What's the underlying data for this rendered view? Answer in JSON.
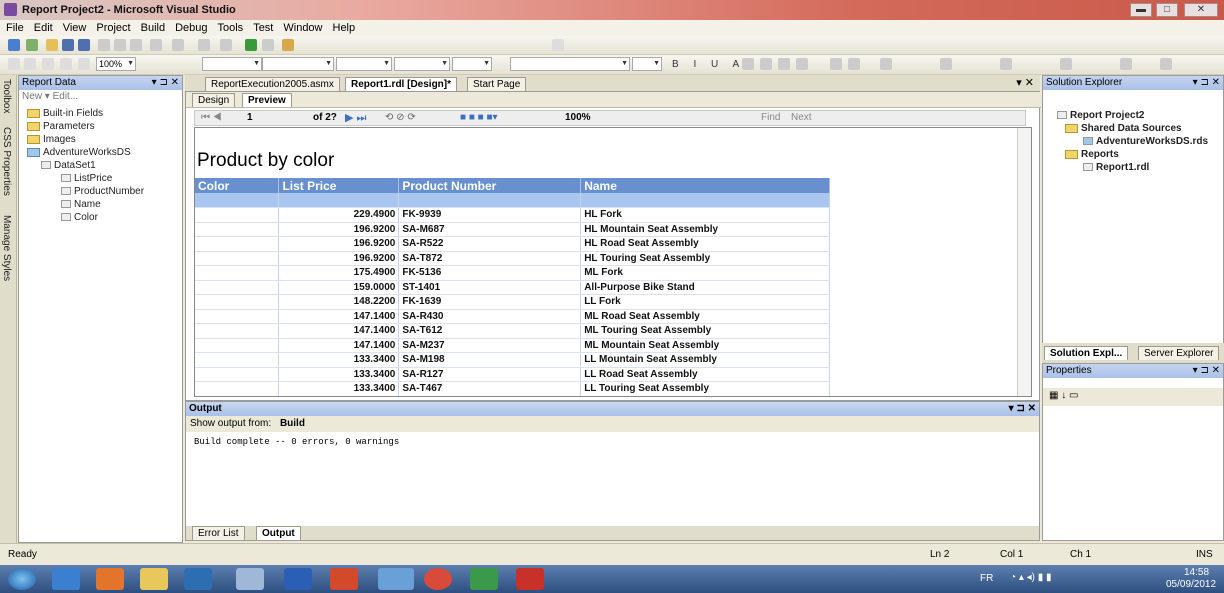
{
  "window": {
    "title": "Report Project2 - Microsoft Visual Studio"
  },
  "menu": [
    "File",
    "Edit",
    "View",
    "Project",
    "Build",
    "Debug",
    "Tools",
    "Test",
    "Window",
    "Help"
  ],
  "toolbar": {
    "zoom_combo": "100%"
  },
  "left_tabs": {
    "toolbox": "Toolbox",
    "css": "CSS Properties",
    "styles": "Manage Styles"
  },
  "report_data": {
    "title": "Report Data",
    "toolbar": "New ▾  Edit...",
    "tree": [
      "Built-in Fields",
      "Parameters",
      "Images",
      "AdventureWorksDS",
      "DataSet1",
      "ListPrice",
      "ProductNumber",
      "Name",
      "Color"
    ]
  },
  "doc_tabs": [
    "ReportExecution2005.asmx",
    "Report1.rdl [Design]*",
    "Start Page"
  ],
  "design_tabs": {
    "design": "Design",
    "preview": "Preview"
  },
  "viewer_toolbar": {
    "page": "1",
    "of": "of 2?",
    "zoom": "100%",
    "find": "Find",
    "next": "Next"
  },
  "report": {
    "title": "Product by color",
    "columns": [
      "Color",
      "List Price",
      "Product Number",
      "Name"
    ],
    "rows": [
      [
        "",
        "229.4900",
        "FK-9939",
        "HL Fork"
      ],
      [
        "",
        "196.9200",
        "SA-M687",
        "HL Mountain Seat Assembly"
      ],
      [
        "",
        "196.9200",
        "SA-R522",
        "HL Road Seat Assembly"
      ],
      [
        "",
        "196.9200",
        "SA-T872",
        "HL Touring Seat Assembly"
      ],
      [
        "",
        "175.4900",
        "FK-5136",
        "ML Fork"
      ],
      [
        "",
        "159.0000",
        "ST-1401",
        "All-Purpose Bike Stand"
      ],
      [
        "",
        "148.2200",
        "FK-1639",
        "LL Fork"
      ],
      [
        "",
        "147.1400",
        "SA-R430",
        "ML Road Seat Assembly"
      ],
      [
        "",
        "147.1400",
        "SA-T612",
        "ML Touring Seat Assembly"
      ],
      [
        "",
        "147.1400",
        "SA-M237",
        "ML Mountain Seat Assembly"
      ],
      [
        "",
        "133.3400",
        "SA-M198",
        "LL Mountain Seat Assembly"
      ],
      [
        "",
        "133.3400",
        "SA-R127",
        "LL Road Seat Assembly"
      ],
      [
        "",
        "133.3400",
        "SA-T467",
        "LL Touring Seat Assembly"
      ]
    ]
  },
  "output": {
    "title": "Output",
    "show_from_label": "Show output from:",
    "show_from_value": "Build",
    "text": "Build complete -- 0 errors, 0 warnings",
    "tabs": [
      "Error List",
      "Output"
    ]
  },
  "solution_explorer": {
    "title": "Solution Explorer",
    "tree": [
      "Report Project2",
      "Shared Data Sources",
      "AdventureWorksDS.rds",
      "Reports",
      "Report1.rdl"
    ],
    "bottom_tabs": [
      "Solution Expl...",
      "Server Explorer"
    ]
  },
  "properties": {
    "title": "Properties"
  },
  "status": {
    "left": "Ready",
    "ln": "Ln 2",
    "col": "Col 1",
    "ch": "Ch 1",
    "ins": "INS"
  },
  "taskbar": {
    "lang": "FR",
    "time": "14:58",
    "date": "05/09/2012"
  },
  "colors": {
    "header_blue": "#6890cf",
    "highlight_row": "#a8c6f0"
  }
}
